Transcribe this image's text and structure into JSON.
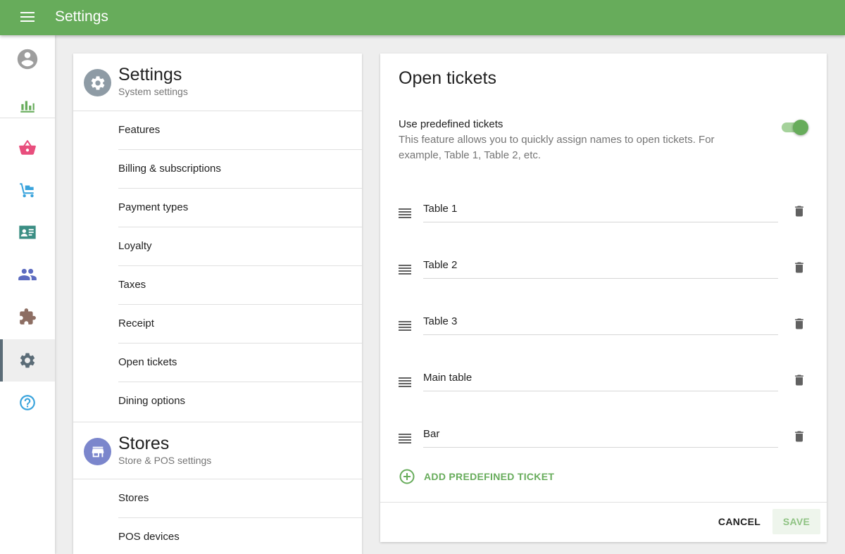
{
  "topbar": {
    "title": "Settings"
  },
  "rail": {
    "items": [
      {
        "icon": "account-circle-icon",
        "color": "#9e9e9e"
      },
      {
        "icon": "bar-chart-icon",
        "color": "#67ac5b"
      },
      {
        "icon": "shopping-basket-icon",
        "color": "#e84e7d"
      },
      {
        "icon": "inventory-dolly-icon",
        "color": "#39a3dc"
      },
      {
        "icon": "employee-card-icon",
        "color": "#3b8e84"
      },
      {
        "icon": "customers-icon",
        "color": "#5c6bc0"
      },
      {
        "icon": "puzzle-piece-icon",
        "color": "#8d6e63"
      },
      {
        "icon": "gear-icon",
        "color": "#5b6c77",
        "active": true
      },
      {
        "icon": "help-circle-icon",
        "color": "#39a3dc"
      }
    ]
  },
  "settings_section": {
    "title": "Settings",
    "subtitle": "System settings",
    "icon": "gear-icon",
    "icon_bg": "#8e9ba5",
    "items": [
      "Features",
      "Billing & subscriptions",
      "Payment types",
      "Loyalty",
      "Taxes",
      "Receipt",
      "Open tickets",
      "Dining options"
    ]
  },
  "stores_section": {
    "title": "Stores",
    "subtitle": "Store & POS settings",
    "icon": "store-icon",
    "icon_bg": "#7b86cc",
    "items": [
      "Stores",
      "POS devices"
    ]
  },
  "panel": {
    "title": "Open tickets",
    "option_label": "Use predefined tickets",
    "option_desc": "This feature allows you to quickly assign names to open tickets. For example, Table 1, Table 2, etc.",
    "toggle_on": true,
    "tickets": [
      "Table 1",
      "Table 2",
      "Table 3",
      "Main table",
      "Bar"
    ],
    "add_label": "ADD PREDEFINED TICKET",
    "cancel_label": "CANCEL",
    "save_label": "SAVE"
  },
  "colors": {
    "primary": "#67ac5b",
    "topbar": "#67ac5b"
  }
}
